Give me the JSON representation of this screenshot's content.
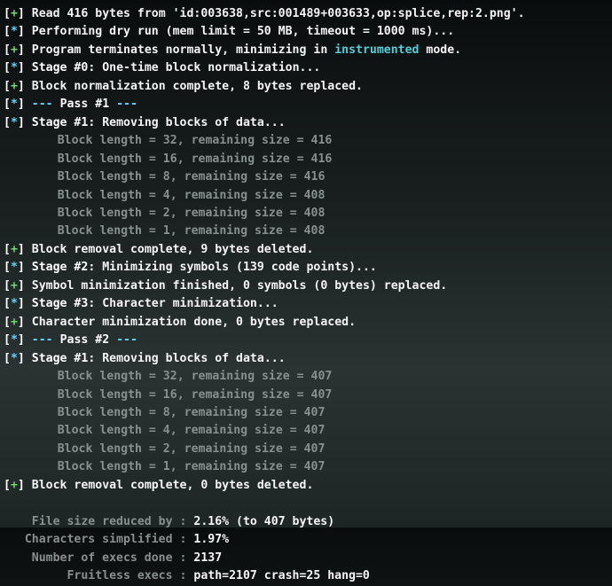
{
  "lines": [
    {
      "tag": "[+]",
      "tagClass": "tag-green",
      "cls": "txt-white",
      "text": "Read 416 bytes from 'id:003638,src:001489+003633,op:splice,rep:2.png'."
    },
    {
      "tag": "[*]",
      "tagClass": "tag-cyan",
      "cls": "txt-white",
      "text": "Performing dry run (mem limit = 50 MB, timeout = 1000 ms)..."
    },
    {
      "tag": "[+]",
      "tagClass": "tag-green",
      "segs": [
        {
          "cls": "txt-white",
          "text": "Program terminates normally, minimizing in "
        },
        {
          "cls": "txt-cyan",
          "text": "instrumented"
        },
        {
          "cls": "txt-white",
          "text": " mode."
        }
      ]
    },
    {
      "tag": "[*]",
      "tagClass": "tag-cyan",
      "segs": [
        {
          "cls": "txt-bold",
          "text": "Stage #0:"
        },
        {
          "cls": "txt-white",
          "text": " One-time block normalization..."
        }
      ]
    },
    {
      "tag": "[+]",
      "tagClass": "tag-green",
      "cls": "txt-white",
      "text": "Block normalization complete, 8 bytes replaced."
    },
    {
      "tag": "[*]",
      "tagClass": "tag-cyan",
      "segs": [
        {
          "cls": "tag-cyan",
          "text": "--- "
        },
        {
          "cls": "txt-bold",
          "text": "Pass #1"
        },
        {
          "cls": "tag-cyan",
          "text": " ---"
        }
      ]
    },
    {
      "tag": "[*]",
      "tagClass": "tag-cyan",
      "segs": [
        {
          "cls": "txt-bold",
          "text": "Stage #1:"
        },
        {
          "cls": "txt-white",
          "text": " Removing blocks of data..."
        }
      ]
    },
    {
      "indent": true,
      "cls": "txt-gray",
      "text": "Block length = 32, remaining size = 416"
    },
    {
      "indent": true,
      "cls": "txt-gray",
      "text": "Block length = 16, remaining size = 416"
    },
    {
      "indent": true,
      "cls": "txt-gray",
      "text": "Block length = 8, remaining size = 416"
    },
    {
      "indent": true,
      "cls": "txt-gray",
      "text": "Block length = 4, remaining size = 408"
    },
    {
      "indent": true,
      "cls": "txt-gray",
      "text": "Block length = 2, remaining size = 408"
    },
    {
      "indent": true,
      "cls": "txt-gray",
      "text": "Block length = 1, remaining size = 408"
    },
    {
      "tag": "[+]",
      "tagClass": "tag-green",
      "cls": "txt-white",
      "text": "Block removal complete, 9 bytes deleted."
    },
    {
      "tag": "[*]",
      "tagClass": "tag-cyan",
      "segs": [
        {
          "cls": "txt-bold",
          "text": "Stage #2:"
        },
        {
          "cls": "txt-white",
          "text": " Minimizing symbols (139 code points)..."
        }
      ]
    },
    {
      "tag": "[+]",
      "tagClass": "tag-green",
      "cls": "txt-white",
      "text": "Symbol minimization finished, 0 symbols (0 bytes) replaced."
    },
    {
      "tag": "[*]",
      "tagClass": "tag-cyan",
      "segs": [
        {
          "cls": "txt-bold",
          "text": "Stage #3:"
        },
        {
          "cls": "txt-white",
          "text": " Character minimization..."
        }
      ]
    },
    {
      "tag": "[+]",
      "tagClass": "tag-green",
      "cls": "txt-white",
      "text": "Character minimization done, 0 bytes replaced."
    },
    {
      "tag": "[*]",
      "tagClass": "tag-cyan",
      "segs": [
        {
          "cls": "tag-cyan",
          "text": "--- "
        },
        {
          "cls": "txt-bold",
          "text": "Pass #2"
        },
        {
          "cls": "tag-cyan",
          "text": " ---"
        }
      ]
    },
    {
      "tag": "[*]",
      "tagClass": "tag-cyan",
      "segs": [
        {
          "cls": "txt-bold",
          "text": "Stage #1:"
        },
        {
          "cls": "txt-white",
          "text": " Removing blocks of data..."
        }
      ]
    },
    {
      "indent": true,
      "cls": "txt-gray",
      "text": "Block length = 32, remaining size = 407"
    },
    {
      "indent": true,
      "cls": "txt-gray",
      "text": "Block length = 16, remaining size = 407"
    },
    {
      "indent": true,
      "cls": "txt-gray",
      "text": "Block length = 8, remaining size = 407"
    },
    {
      "indent": true,
      "cls": "txt-gray",
      "text": "Block length = 4, remaining size = 407"
    },
    {
      "indent": true,
      "cls": "txt-gray",
      "text": "Block length = 2, remaining size = 407"
    },
    {
      "indent": true,
      "cls": "txt-gray",
      "text": "Block length = 1, remaining size = 407"
    },
    {
      "tag": "[+]",
      "tagClass": "tag-green",
      "cls": "txt-white",
      "text": "Block removal complete, 0 bytes deleted."
    }
  ],
  "stats": [
    {
      "label": "    File size reduced by : ",
      "value": "2.16% (to 407 bytes)"
    },
    {
      "label": "   Characters simplified : ",
      "value": "1.97%"
    },
    {
      "label": "    Number of execs done : ",
      "value": "2137"
    },
    {
      "label": "         Fruitless execs : ",
      "value": "path=2107 crash=25 hang=0"
    }
  ]
}
